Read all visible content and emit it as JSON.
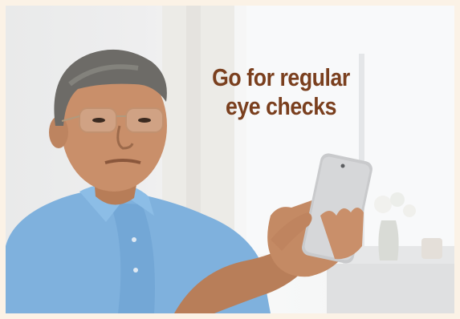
{
  "headline": {
    "line1": "Go for regular",
    "line2": "eye checks"
  },
  "colors": {
    "frame": "#fbf2e6",
    "headline_text": "#7a3f1e",
    "shirt": "#7fb1dd",
    "skin": "#c98f6a",
    "hair": "#6d6b67",
    "phone": "#c9cacc"
  }
}
